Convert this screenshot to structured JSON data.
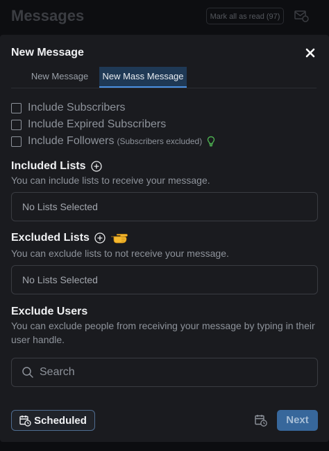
{
  "background": {
    "page_title": "Messages",
    "mark_all_read": "Mark all as read (97)"
  },
  "modal": {
    "title": "New Message",
    "tabs": [
      {
        "label": "New Message",
        "active": false
      },
      {
        "label": "New Mass Message",
        "active": true
      }
    ],
    "checkboxes": [
      {
        "label": "Include Subscribers",
        "checked": false
      },
      {
        "label": "Include Expired Subscribers",
        "checked": false
      },
      {
        "label": "Include Followers",
        "note": "(Subscribers excluded)",
        "checked": false
      }
    ],
    "included_lists": {
      "title": "Included Lists",
      "description": "You can include lists to receive your message.",
      "value": "No Lists Selected"
    },
    "excluded_lists": {
      "title": "Excluded Lists",
      "description": "You can exclude lists to not receive your message.",
      "value": "No Lists Selected"
    },
    "exclude_users": {
      "title": "Exclude Users",
      "description": "You can exclude people from receiving your message by typing in their user handle.",
      "search_placeholder": "Search"
    },
    "footer": {
      "scheduled_label": "Scheduled",
      "next_label": "Next"
    }
  },
  "colors": {
    "accent": "#4a90e2",
    "modal_bg": "#1a1b1f",
    "next_button": "#37679b",
    "bulb": "#4caf50"
  },
  "icons": [
    "mail-settings-icon",
    "close-icon",
    "lightbulb-icon",
    "plus-circle-icon",
    "pointing-hand-icon",
    "search-icon",
    "calendar-clock-icon"
  ]
}
